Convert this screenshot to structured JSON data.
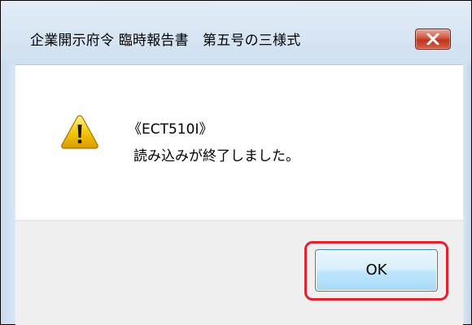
{
  "dialog": {
    "title": "企業開示府令 臨時報告書　第五号の三様式",
    "message_code": "《ECT510I》",
    "message_text": "読み込みが終了しました。",
    "icon": "warning-icon",
    "close_icon": "close-icon"
  },
  "buttons": {
    "ok_label": "OK"
  },
  "colors": {
    "highlight": "#e0222c",
    "close_button": "#c2331d",
    "ok_button": "#bee6fd",
    "warning_icon": "#f5c400"
  }
}
